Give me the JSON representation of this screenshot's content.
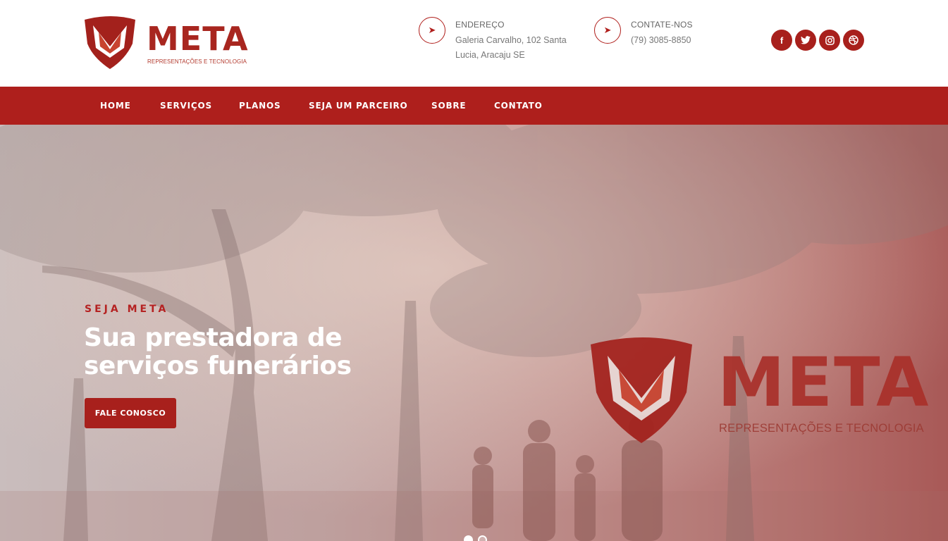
{
  "brand": {
    "name": "META",
    "tagline": "REPRESENTAÇÕES E TECNOLOGIA",
    "color": "#ae1f1c"
  },
  "header": {
    "address": {
      "icon": "location-arrow-icon",
      "title": "ENDEREÇO",
      "line1": "Galeria Carvalho, 102 Santa",
      "line2": "Lucia, Aracaju SE"
    },
    "contact": {
      "icon": "location-arrow-icon",
      "title": "CONTATE-NOS",
      "phone": "(79) 3085-8850"
    },
    "socials": [
      {
        "name": "facebook-icon",
        "glyph": "f"
      },
      {
        "name": "twitter-icon",
        "glyph": "🐦"
      },
      {
        "name": "instagram-icon",
        "glyph": "◎"
      },
      {
        "name": "dribbble-icon",
        "glyph": "⊛"
      }
    ]
  },
  "nav": {
    "items": [
      "HOME",
      "SERVIÇOS",
      "PLANOS",
      "SEJA UM PARCEIRO",
      "SOBRE",
      "CONTATO"
    ]
  },
  "hero": {
    "kicker": "SEJA META",
    "headline_line1": "Sua prestadora de",
    "headline_line2": "serviços funerários",
    "cta": "FALE CONOSCO",
    "logo_word": "META",
    "logo_sub": "REPRESENTAÇÕES E TECNOLOGIA",
    "slides": 2,
    "active_slide": 1
  }
}
